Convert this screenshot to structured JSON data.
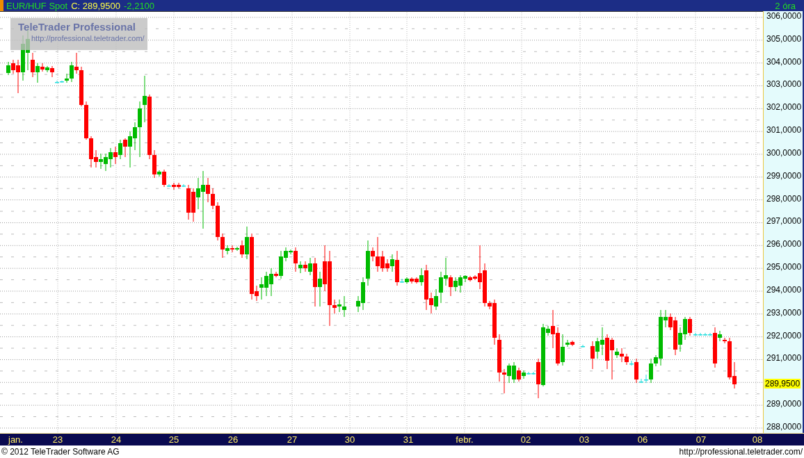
{
  "header": {
    "instrument": "EUR/HUF Spot",
    "close": "C: 289,9500",
    "change": "-2,2100",
    "interval": "2 óra"
  },
  "logo": {
    "title": "TeleTrader Professional",
    "url": "http://professional.teletrader.com/"
  },
  "y_axis": {
    "labels": [
      "306,0000",
      "305,0000",
      "304,0000",
      "303,0000",
      "302,0000",
      "301,0000",
      "300,0000",
      "299,0000",
      "298,0000",
      "297,0000",
      "296,0000",
      "295,0000",
      "294,0000",
      "293,0000",
      "292,0000",
      "291,0000",
      "289,0000",
      "288,0000"
    ],
    "last_price": "289,9500"
  },
  "x_axis": {
    "labels": [
      "jan.",
      "23",
      "24",
      "25",
      "26",
      "27",
      "30",
      "31",
      "febr.",
      "02",
      "03",
      "06",
      "07",
      "08"
    ]
  },
  "footer": {
    "copyright": "© 2012 TeleTrader Software AG",
    "url": "http://professional.teletrader.com/"
  }
}
